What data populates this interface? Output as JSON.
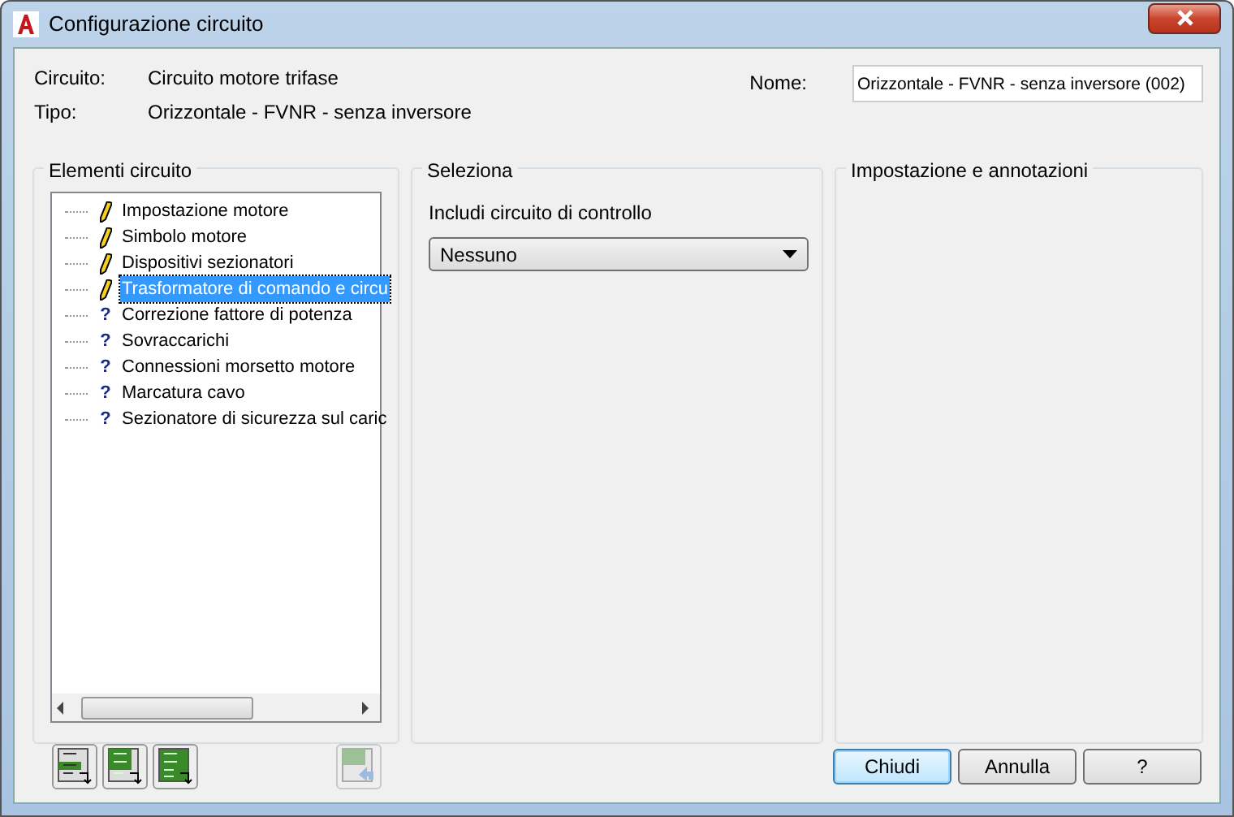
{
  "window": {
    "title": "Configurazione circuito"
  },
  "info": [
    {
      "label": "Circuito:",
      "value": "Circuito motore trifase"
    },
    {
      "label": "Tipo:",
      "value": "Orizzontale - FVNR - senza inversore"
    }
  ],
  "name_field": {
    "label": "Nome:",
    "value": "Orizzontale - FVNR - senza inversore (002)"
  },
  "elements_group": {
    "title": "Elementi circuito",
    "items": [
      {
        "kind": "edit",
        "label": "Impostazione motore",
        "selected": false
      },
      {
        "kind": "edit",
        "label": "Simbolo motore",
        "selected": false
      },
      {
        "kind": "edit",
        "label": "Dispositivi sezionatori",
        "selected": false
      },
      {
        "kind": "edit",
        "label": "Trasformatore di comando e circu",
        "selected": true
      },
      {
        "kind": "pending",
        "marker": "?",
        "label": "Correzione fattore di potenza",
        "selected": false
      },
      {
        "kind": "pending",
        "marker": "?",
        "label": "Sovraccarichi",
        "selected": false
      },
      {
        "kind": "pending",
        "marker": "?",
        "label": "Connessioni morsetto motore",
        "selected": false
      },
      {
        "kind": "pending",
        "marker": "?",
        "label": "Marcatura cavo",
        "selected": false
      },
      {
        "kind": "pending",
        "marker": "?",
        "label": "Sezionatore di sicurezza sul caric",
        "selected": false
      }
    ]
  },
  "select_group": {
    "title": "Seleziona",
    "field_label": "Includi circuito di controllo",
    "dropdown_value": "Nessuno"
  },
  "settings_group": {
    "title": "Impostazione e annotazioni"
  },
  "tool_buttons": [
    {
      "kind": "insert-one",
      "disabled": false
    },
    {
      "kind": "insert-some",
      "disabled": false
    },
    {
      "kind": "insert-all",
      "disabled": false
    },
    {
      "kind": "restore",
      "disabled": true
    }
  ],
  "buttons": [
    {
      "label": "Chiudi",
      "default": true
    },
    {
      "label": "Annulla",
      "default": false
    },
    {
      "label": "?",
      "default": false
    }
  ]
}
